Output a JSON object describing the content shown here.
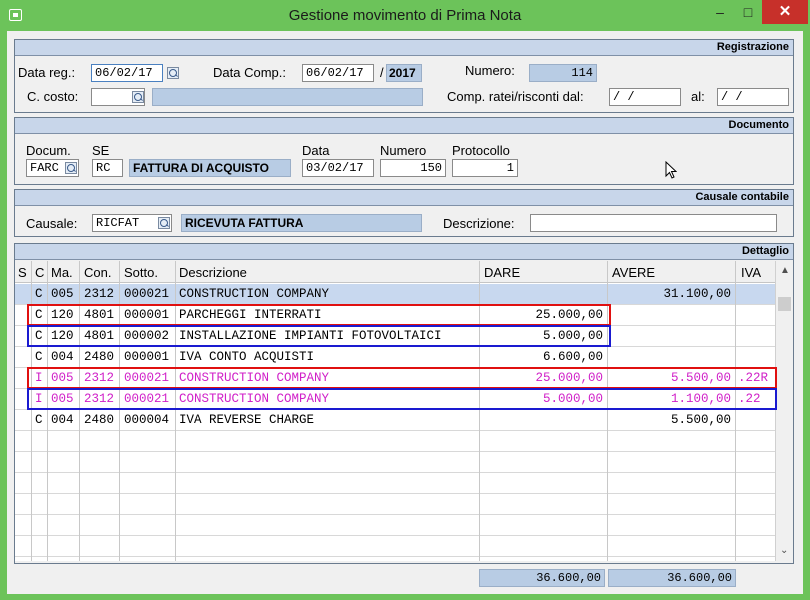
{
  "window": {
    "title": "Gestione movimento di Prima Nota"
  },
  "registrazione": {
    "header": "Registrazione",
    "data_reg_label": "Data reg.:",
    "data_reg": "06/02/17",
    "data_comp_label": "Data Comp.:",
    "data_comp": "06/02/17",
    "sep": "/",
    "anno": "2017",
    "numero_label": "Numero:",
    "numero": "114",
    "ccosto_label": "C. costo:",
    "ccosto": "",
    "ccosto_desc": "",
    "ratei_label": "Comp. ratei/risconti dal:",
    "ratei_dal": " /  /",
    "al_label": "al:",
    "ratei_al": " /  /"
  },
  "documento": {
    "header": "Documento",
    "docum_label": "Docum.",
    "docum": "FARC",
    "se_label": "SE",
    "se": "RC",
    "se_desc": "FATTURA DI ACQUISTO",
    "data_label": "Data",
    "data": "03/02/17",
    "numero_label": "Numero",
    "numero": "150",
    "protocollo_label": "Protocollo",
    "protocollo": "1"
  },
  "causale": {
    "header": "Causale contabile",
    "causale_label": "Causale:",
    "causale": "RICFAT",
    "causale_desc": "RICEVUTA FATTURA",
    "descrizione_label": "Descrizione:",
    "descrizione": ""
  },
  "dettaglio": {
    "header": "Dettaglio",
    "columns": [
      "S",
      "C",
      "Ma.",
      "Con.",
      "Sotto.",
      "Descrizione",
      "DARE",
      "AVERE",
      "IVA"
    ],
    "rows": [
      {
        "s": "",
        "c": "C",
        "ma": "005",
        "con": "2312",
        "sotto": "000021",
        "desc": "CONSTRUCTION COMPANY",
        "dare": "",
        "avere": "31.100,00",
        "iva": ""
      },
      {
        "s": "",
        "c": "C",
        "ma": "120",
        "con": "4801",
        "sotto": "000001",
        "desc": "PARCHEGGI INTERRATI",
        "dare": "25.000,00",
        "avere": "",
        "iva": ""
      },
      {
        "s": "",
        "c": "C",
        "ma": "120",
        "con": "4801",
        "sotto": "000002",
        "desc": "INSTALLAZIONE IMPIANTI FOTOVOLTAICI",
        "dare": "5.000,00",
        "avere": "",
        "iva": ""
      },
      {
        "s": "",
        "c": "C",
        "ma": "004",
        "con": "2480",
        "sotto": "000001",
        "desc": "IVA CONTO ACQUISTI",
        "dare": "6.600,00",
        "avere": "",
        "iva": ""
      },
      {
        "s": "",
        "c": "I",
        "ma": "005",
        "con": "2312",
        "sotto": "000021",
        "desc": "CONSTRUCTION COMPANY",
        "dare": "25.000,00",
        "avere": "5.500,00",
        "iva": ".22R"
      },
      {
        "s": "",
        "c": "I",
        "ma": "005",
        "con": "2312",
        "sotto": "000021",
        "desc": "CONSTRUCTION COMPANY",
        "dare": "5.000,00",
        "avere": "1.100,00",
        "iva": ".22"
      },
      {
        "s": "",
        "c": "C",
        "ma": "004",
        "con": "2480",
        "sotto": "000004",
        "desc": "IVA REVERSE CHARGE",
        "dare": "",
        "avere": "5.500,00",
        "iva": ""
      }
    ],
    "totale_dare": "36.600,00",
    "totale_avere": "36.600,00"
  },
  "colors": {
    "titlebar": "#6cc35a",
    "panel_header": "#c8d6ea",
    "iva_rows": "#d020c8",
    "highlight_red": "#e01010",
    "highlight_blue": "#1a1ad0"
  }
}
